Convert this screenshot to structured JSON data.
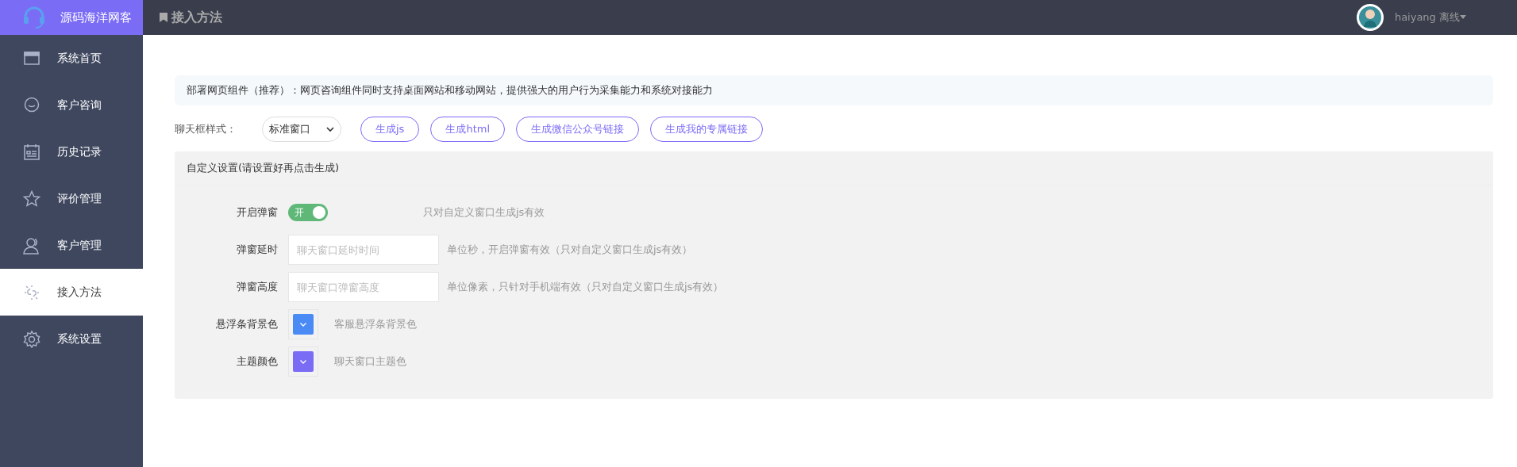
{
  "brand": {
    "name": "源码海洋网客"
  },
  "sidebar": {
    "items": [
      {
        "label": "系统首页",
        "kind": "window",
        "selected": false
      },
      {
        "label": "客户咨询",
        "kind": "chat",
        "selected": false
      },
      {
        "label": "历史记录",
        "kind": "calendar",
        "selected": false
      },
      {
        "label": "评价管理",
        "kind": "star",
        "selected": false
      },
      {
        "label": "客户管理",
        "kind": "user",
        "selected": false
      },
      {
        "label": "接入方法",
        "kind": "link",
        "selected": true
      },
      {
        "label": "系统设置",
        "kind": "gear",
        "selected": false
      }
    ]
  },
  "header": {
    "title": "接入方法",
    "user": {
      "name": "haiyang 离线"
    }
  },
  "notice": "部署网页组件（推荐）：网页咨询组件同时支持桌面网站和移动网站，提供强大的用户行为采集能力和系统对接能力",
  "style_row": {
    "label": "聊天框样式：",
    "select_value": "标准窗口",
    "buttons": [
      "生成js",
      "生成html",
      "生成微信公众号链接",
      "生成我的专属链接"
    ]
  },
  "settings": {
    "title": "自定义设置(请设置好再点击生成)",
    "rows": [
      {
        "kind": "switch",
        "label": "开启弹窗",
        "on": true,
        "switch_text": "开",
        "hint": "只对自定义窗口生成js有效"
      },
      {
        "kind": "input",
        "label": "弹窗延时",
        "placeholder": "聊天窗口延时时间",
        "hint": "单位秒，开启弹窗有效（只对自定义窗口生成js有效）"
      },
      {
        "kind": "input",
        "label": "弹窗高度",
        "placeholder": "聊天窗口弹窗高度",
        "hint": "单位像素，只针对手机端有效（只对自定义窗口生成js有效）"
      },
      {
        "kind": "color",
        "label": "悬浮条背景色",
        "color": "#4a8af4",
        "hint": "客服悬浮条背景色"
      },
      {
        "kind": "color",
        "label": "主题颜色",
        "color": "#7b6cf6",
        "hint": "聊天窗口主题色"
      }
    ]
  }
}
